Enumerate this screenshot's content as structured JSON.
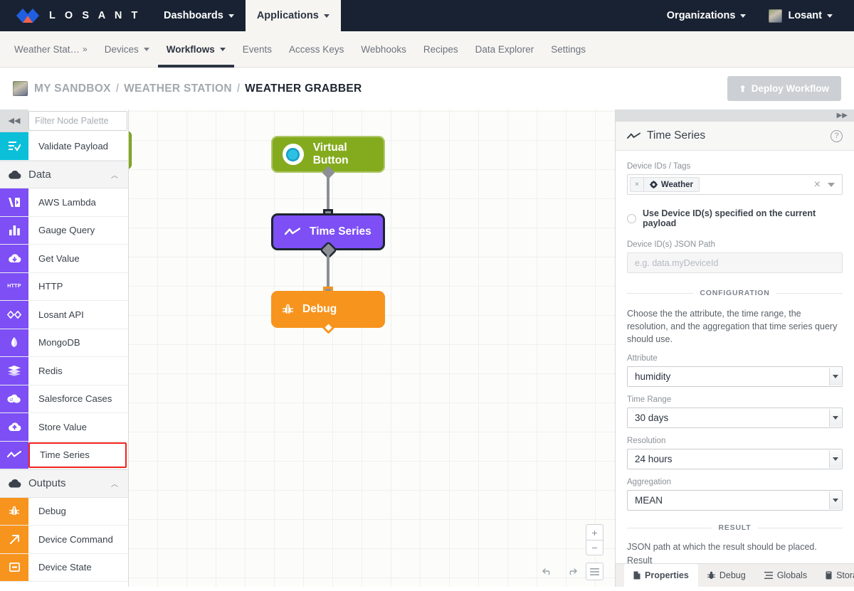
{
  "topnav": {
    "brand": "L O S A N T",
    "brand_logo_icon": "losant-diamond-logo",
    "items": [
      {
        "label": "Dashboards",
        "has_caret": true,
        "active": false
      },
      {
        "label": "Applications",
        "has_caret": true,
        "active": true
      }
    ],
    "right": [
      {
        "label": "Organizations",
        "has_caret": true
      },
      {
        "label": "Losant",
        "has_caret": true,
        "avatar": true
      }
    ]
  },
  "subnav": {
    "items": [
      {
        "label": "Weather Stat…",
        "suffix": "»",
        "active": false
      },
      {
        "label": "Devices",
        "caret": true,
        "active": false
      },
      {
        "label": "Workflows",
        "caret": true,
        "active": true
      },
      {
        "label": "Events",
        "active": false
      },
      {
        "label": "Access Keys",
        "active": false
      },
      {
        "label": "Webhooks",
        "active": false
      },
      {
        "label": "Recipes",
        "active": false
      },
      {
        "label": "Data Explorer",
        "active": false
      },
      {
        "label": "Settings",
        "active": false
      }
    ]
  },
  "breadcrumb": {
    "avatar_icon": "user-avatar",
    "items": [
      "MY SANDBOX",
      "WEATHER STATION",
      "WEATHER GRABBER"
    ],
    "separator": "/",
    "deploy_button": {
      "label": "Deploy Workflow",
      "icon": "upload-icon",
      "disabled_color": "#ccd0d4"
    }
  },
  "palette": {
    "collapse_icon": "chevron-double-left-icon",
    "filter_placeholder": "Filter Node Palette",
    "filter_value": "",
    "rows": [
      {
        "label": "Validate Payload",
        "icon": "validate-payload-icon",
        "color": "#0bbfd9",
        "type": "node",
        "selected": false
      },
      {
        "label": "Data",
        "icon": "cloud-icon",
        "type": "group",
        "chevron": "⌃"
      },
      {
        "label": "AWS Lambda",
        "icon": "aws-lambda-icon",
        "color": "#7d4ff5",
        "type": "node",
        "selected": false
      },
      {
        "label": "Gauge Query",
        "icon": "bar-chart-icon",
        "color": "#7d4ff5",
        "type": "node",
        "selected": false
      },
      {
        "label": "Get Value",
        "icon": "cloud-download-icon",
        "color": "#7d4ff5",
        "type": "node",
        "selected": false
      },
      {
        "label": "HTTP",
        "icon": "http-icon",
        "color": "#7d4ff5",
        "type": "node",
        "selected": false
      },
      {
        "label": "Losant API",
        "icon": "losant-api-icon",
        "color": "#7d4ff5",
        "type": "node",
        "selected": false
      },
      {
        "label": "MongoDB",
        "icon": "mongodb-leaf-icon",
        "color": "#7d4ff5",
        "type": "node",
        "selected": false
      },
      {
        "label": "Redis",
        "icon": "redis-stack-icon",
        "color": "#7d4ff5",
        "type": "node",
        "selected": false
      },
      {
        "label": "Salesforce Cases",
        "icon": "salesforce-cloud-icon",
        "color": "#7d4ff5",
        "type": "node",
        "selected": false
      },
      {
        "label": "Store Value",
        "icon": "cloud-upload-icon",
        "color": "#7d4ff5",
        "type": "node",
        "selected": false
      },
      {
        "label": "Time Series",
        "icon": "time-series-icon",
        "color": "#7d4ff5",
        "type": "node",
        "selected": true
      },
      {
        "label": "Outputs",
        "icon": "cloud-icon",
        "type": "group",
        "chevron": "⌃"
      },
      {
        "label": "Debug",
        "icon": "bug-icon",
        "color": "#f7941e",
        "type": "node",
        "selected": false
      },
      {
        "label": "Device Command",
        "icon": "arrow-up-right-icon",
        "color": "#f7941e",
        "type": "node",
        "selected": false
      },
      {
        "label": "Device State",
        "icon": "device-state-icon",
        "color": "#f7941e",
        "type": "node",
        "selected": false
      }
    ],
    "selection_outline_color": "#f0231b"
  },
  "canvas": {
    "nodes": [
      {
        "label": "Virtual Button",
        "icon": "virtual-button-icon",
        "color": "#84ab1e",
        "selected": false
      },
      {
        "label": "Time Series",
        "icon": "time-series-icon",
        "color": "#7d4ff5",
        "selected": true
      },
      {
        "label": "Debug",
        "icon": "bug-icon",
        "color": "#f7941e",
        "selected": false
      }
    ],
    "controls": {
      "zoom_in": "+",
      "zoom_out": "−",
      "undo": "undo-icon",
      "redo": "redo-icon",
      "menu": "hamburger-menu-icon"
    }
  },
  "rightpanel": {
    "expand_icon": "chevron-double-right-icon",
    "title": "Time Series",
    "title_icon": "time-series-icon",
    "help_icon": "question-mark-icon",
    "device_ids_label": "Device IDs / Tags",
    "device_tag": {
      "text": "Weather",
      "icon": "tag-gear-icon",
      "remove": "×"
    },
    "select_clear": "×",
    "radio_label": "Use Device ID(s) specified on the current payload",
    "radio_checked": false,
    "json_path_label": "Device ID(s) JSON Path",
    "json_path_placeholder": "e.g. data.myDeviceId",
    "json_path_value": "",
    "configuration_header": "CONFIGURATION",
    "configuration_desc": "Choose the the attribute, the time range, the resolution, and the aggregation that time series query should use.",
    "fields": [
      {
        "label": "Attribute",
        "value": "humidity"
      },
      {
        "label": "Time Range",
        "value": "30 days"
      },
      {
        "label": "Resolution",
        "value": "24 hours"
      },
      {
        "label": "Aggregation",
        "value": "MEAN"
      }
    ],
    "result_header": "RESULT",
    "result_desc": "JSON path at which the result should be placed. Result",
    "tabs": [
      {
        "label": "Properties",
        "icon": "document-icon",
        "active": true
      },
      {
        "label": "Debug",
        "icon": "bug-icon",
        "active": false
      },
      {
        "label": "Globals",
        "icon": "list-icon",
        "active": false
      },
      {
        "label": "Storage",
        "icon": "storage-icon",
        "active": false
      }
    ]
  }
}
